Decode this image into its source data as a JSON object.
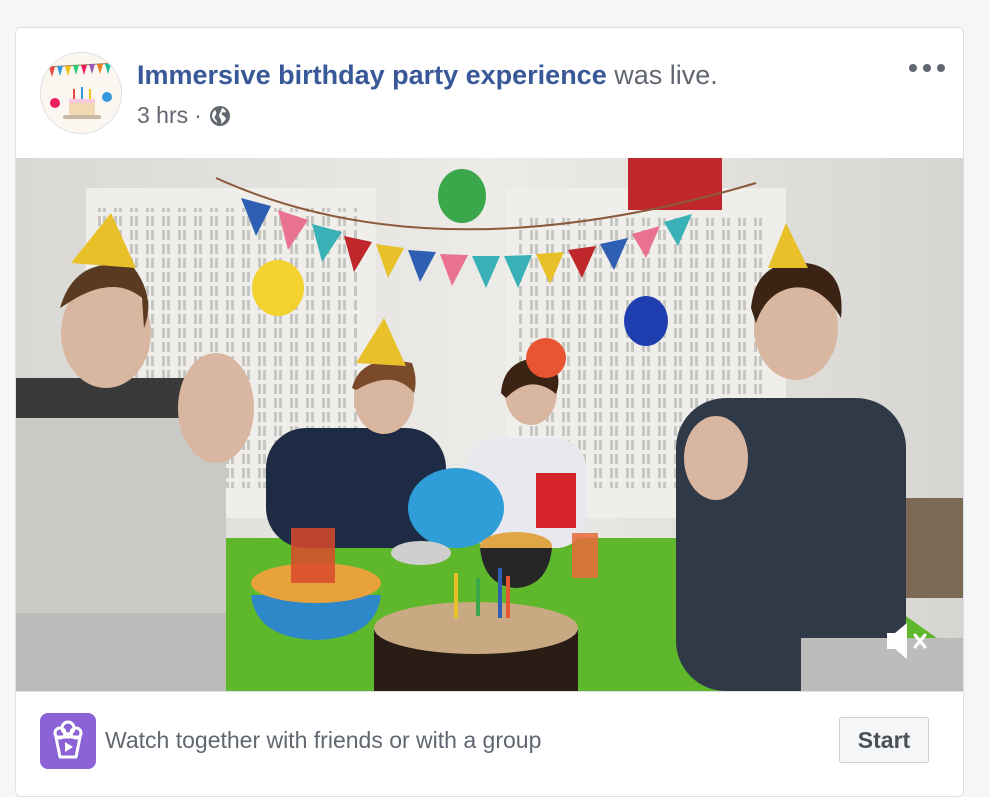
{
  "post": {
    "page_name": "Immersive birthday party experience",
    "action_text": "was live.",
    "timestamp": "3 hrs",
    "separator": "·",
    "privacy_icon": "globe-icon",
    "more_icon": "more-options-icon"
  },
  "video": {
    "description_icon": "birthday-party-live-video",
    "mute_icon": "speaker-muted-icon"
  },
  "footer": {
    "watch_icon": "watch-party-popcorn-icon",
    "watch_text": "Watch together with friends or with a group",
    "start_label": "Start"
  },
  "colors": {
    "link": "#385898",
    "secondary_text": "#606770",
    "watch_icon_bg": "#8c63d6",
    "table_green": "#5fb82c"
  }
}
